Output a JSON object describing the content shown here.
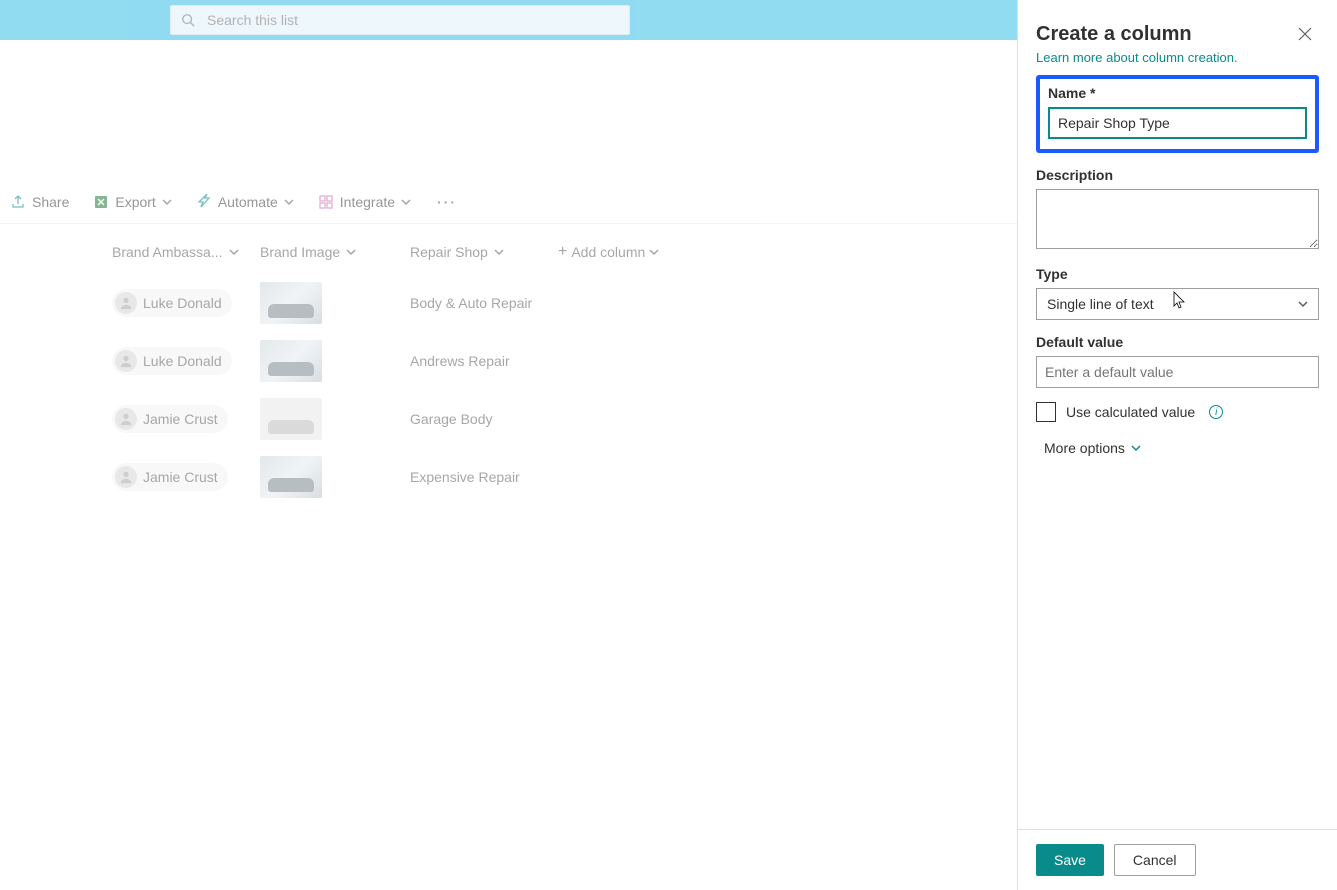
{
  "topbar": {
    "search_placeholder": "Search this list"
  },
  "cmdbar": {
    "share": "Share",
    "export": "Export",
    "automate": "Automate",
    "integrate": "Integrate"
  },
  "columns": {
    "ambassador": "Brand Ambassa...",
    "image": "Brand Image",
    "shop": "Repair Shop",
    "add": "Add column"
  },
  "rows": [
    {
      "ambassador": "Luke Donald",
      "shop": "Body & Auto Repair"
    },
    {
      "ambassador": "Luke Donald",
      "shop": "Andrews Repair"
    },
    {
      "ambassador": "Jamie Crust",
      "shop": "Garage Body"
    },
    {
      "ambassador": "Jamie Crust",
      "shop": "Expensive Repair"
    }
  ],
  "panel": {
    "title": "Create a column",
    "learn": "Learn more about column creation.",
    "name_label": "Name *",
    "name_value": "Repair Shop Type",
    "desc_label": "Description",
    "desc_value": "",
    "type_label": "Type",
    "type_value": "Single line of text",
    "default_label": "Default value",
    "default_placeholder": "Enter a default value",
    "calc_label": "Use calculated value",
    "more": "More options",
    "save": "Save",
    "cancel": "Cancel"
  }
}
